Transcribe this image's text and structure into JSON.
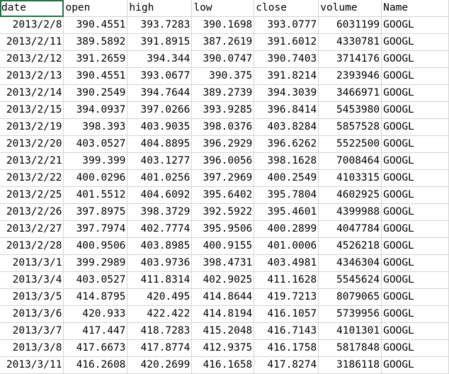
{
  "sheet": {
    "headers": [
      "date",
      "open",
      "high",
      "low",
      "close",
      "volume",
      "Name"
    ],
    "rows": [
      [
        "2013/2/8",
        "390.4551",
        "393.7283",
        "390.1698",
        "393.0777",
        "6031199",
        "GOOGL"
      ],
      [
        "2013/2/11",
        "389.5892",
        "391.8915",
        "387.2619",
        "391.6012",
        "4330781",
        "GOOGL"
      ],
      [
        "2013/2/12",
        "391.2659",
        "394.344",
        "390.0747",
        "390.7403",
        "3714176",
        "GOOGL"
      ],
      [
        "2013/2/13",
        "390.4551",
        "393.0677",
        "390.375",
        "391.8214",
        "2393946",
        "GOOGL"
      ],
      [
        "2013/2/14",
        "390.2549",
        "394.7644",
        "389.2739",
        "394.3039",
        "3466971",
        "GOOGL"
      ],
      [
        "2013/2/15",
        "394.0937",
        "397.0266",
        "393.9285",
        "396.8414",
        "5453980",
        "GOOGL"
      ],
      [
        "2013/2/19",
        "398.393",
        "403.9035",
        "398.0376",
        "403.8284",
        "5857528",
        "GOOGL"
      ],
      [
        "2013/2/20",
        "403.0527",
        "404.8895",
        "396.2929",
        "396.6262",
        "5522500",
        "GOOGL"
      ],
      [
        "2013/2/21",
        "399.399",
        "403.1277",
        "396.0056",
        "398.1628",
        "7008464",
        "GOOGL"
      ],
      [
        "2013/2/22",
        "400.0296",
        "401.0256",
        "397.2969",
        "400.2549",
        "4103315",
        "GOOGL"
      ],
      [
        "2013/2/25",
        "401.5512",
        "404.6092",
        "395.6402",
        "395.7804",
        "4602925",
        "GOOGL"
      ],
      [
        "2013/2/26",
        "397.8975",
        "398.3729",
        "392.5922",
        "395.4601",
        "4399988",
        "GOOGL"
      ],
      [
        "2013/2/27",
        "397.7974",
        "402.7774",
        "395.9506",
        "400.2899",
        "4047784",
        "GOOGL"
      ],
      [
        "2013/2/28",
        "400.9506",
        "403.8985",
        "400.9155",
        "401.0006",
        "4526218",
        "GOOGL"
      ],
      [
        "2013/3/1",
        "399.2989",
        "403.9736",
        "398.4731",
        "403.4981",
        "4346304",
        "GOOGL"
      ],
      [
        "2013/3/4",
        "403.0527",
        "411.8314",
        "402.9025",
        "411.1628",
        "5545624",
        "GOOGL"
      ],
      [
        "2013/3/5",
        "414.8795",
        "420.495",
        "414.8644",
        "419.7213",
        "8079065",
        "GOOGL"
      ],
      [
        "2013/3/6",
        "420.933",
        "422.422",
        "414.8194",
        "416.1057",
        "5739956",
        "GOOGL"
      ],
      [
        "2013/3/7",
        "417.447",
        "418.7283",
        "415.2048",
        "416.7143",
        "4101301",
        "GOOGL"
      ],
      [
        "2013/3/8",
        "417.6673",
        "417.8774",
        "412.9375",
        "416.1758",
        "5817848",
        "GOOGL"
      ],
      [
        "2013/3/11",
        "416.2608",
        "420.2699",
        "416.1658",
        "417.8274",
        "3186118",
        "GOOGL"
      ]
    ]
  }
}
